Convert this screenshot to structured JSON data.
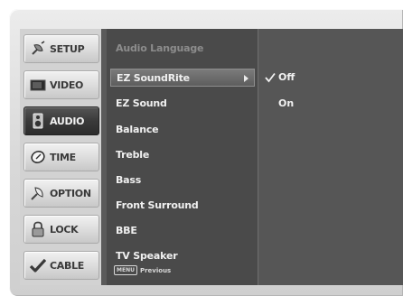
{
  "categories": [
    {
      "label": "SETUP",
      "icon": "satellite-dish-icon",
      "active": false
    },
    {
      "label": "VIDEO",
      "icon": "tv-screen-icon",
      "active": false
    },
    {
      "label": "AUDIO",
      "icon": "speaker-icon",
      "active": true
    },
    {
      "label": "TIME",
      "icon": "clock-icon",
      "active": false
    },
    {
      "label": "OPTION",
      "icon": "satellite-option-icon",
      "active": false
    },
    {
      "label": "LOCK",
      "icon": "padlock-icon",
      "active": false
    },
    {
      "label": "CABLE",
      "icon": "checkmark-icon",
      "active": false
    }
  ],
  "submenu": {
    "items": [
      {
        "label": "Audio Language",
        "state": "disabled"
      },
      {
        "label": "EZ SoundRite",
        "state": "highlighted"
      },
      {
        "label": "EZ Sound",
        "state": "normal"
      },
      {
        "label": "Balance",
        "state": "normal"
      },
      {
        "label": "Treble",
        "state": "normal"
      },
      {
        "label": "Bass",
        "state": "normal"
      },
      {
        "label": "Front Surround",
        "state": "normal"
      },
      {
        "label": "BBE",
        "state": "normal"
      },
      {
        "label": "TV Speaker",
        "state": "normal"
      }
    ],
    "preview_badge": "MENU",
    "preview_label": "Previous"
  },
  "options": {
    "items": [
      {
        "label": "Off",
        "selected": true
      },
      {
        "label": "On",
        "selected": false
      }
    ]
  },
  "colors": {
    "osd_background": "#5a5a5a",
    "active_tab": "#3a3a3a",
    "bezel": "#d8d8d8"
  }
}
